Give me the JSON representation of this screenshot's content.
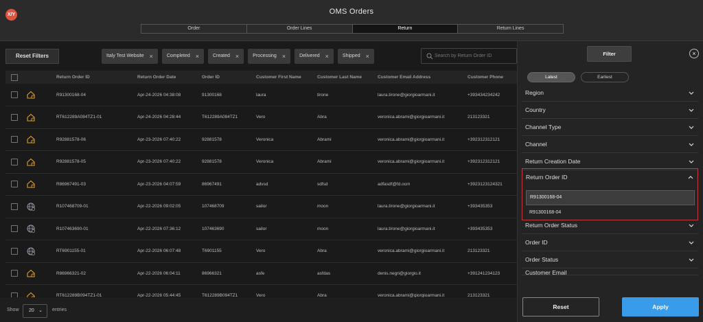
{
  "app": {
    "logo_text": "X/Y",
    "title": "OMS Orders"
  },
  "tabs": [
    {
      "label": "Order",
      "active": false
    },
    {
      "label": "Order Lines",
      "active": false
    },
    {
      "label": "Return",
      "active": true
    },
    {
      "label": "Return Lines",
      "active": false
    }
  ],
  "toolbar": {
    "reset_filters_label": "Reset Filters",
    "chips": [
      "Italy Test Website",
      "Completed",
      "Created",
      "Processing",
      "Delivered",
      "Shipped"
    ],
    "search_placeholder": "Search by Return Order ID"
  },
  "table": {
    "columns": [
      "Return Order ID",
      "Return Order Date",
      "Order ID",
      "Customer First Name",
      "Customer Last Name",
      "Customer Email Address",
      "Customer Phone"
    ],
    "rows": [
      {
        "icon": "home-icon",
        "id": "R91300168-04",
        "date": "Apr-24-2026 04:38:08",
        "order_id": "91300168",
        "first": "laura",
        "last": "tirone",
        "email": "laura.tirone@giorgioarmani.it",
        "phone": "+393434234242"
      },
      {
        "icon": "home-icon",
        "id": "RT612289A084TZ1-01",
        "date": "Apr-24-2026 04:28:44",
        "order_id": "T612289A084TZ1",
        "first": "Vero",
        "last": "Abra",
        "email": "veronica.abrami@giorgioarmani.it",
        "phone": "213123321"
      },
      {
        "icon": "home-icon",
        "id": "R92881578-06",
        "date": "Apr-23-2026 07:40:22",
        "order_id": "92881578",
        "first": "Veronica",
        "last": "Abrami",
        "email": "veronica.abrami@giorgioarmani.it",
        "phone": "+392312312121"
      },
      {
        "icon": "home-icon",
        "id": "R92881578-05",
        "date": "Apr-23-2026 07:40:22",
        "order_id": "92881578",
        "first": "Veronica",
        "last": "Abrami",
        "email": "veronica.abrami@giorgioarmani.it",
        "phone": "+392312312121"
      },
      {
        "icon": "home-icon",
        "id": "R86967491-03",
        "date": "Apr-23-2026 04:07:59",
        "order_id": "86967491",
        "first": "advsd",
        "last": "sdfsd",
        "email": "adfasdf@fd.ocm",
        "phone": "+3923123124321"
      },
      {
        "icon": "globe-icon",
        "id": "R107468709-01",
        "date": "Apr-22-2026 09:02:05",
        "order_id": "107468709",
        "first": "sailor",
        "last": "moon",
        "email": "laura.tirone@giorgioarmani.it",
        "phone": "+393435353"
      },
      {
        "icon": "globe-icon",
        "id": "R107463690-01",
        "date": "Apr-22-2026 07:36:12",
        "order_id": "107463690",
        "first": "sailor",
        "last": "moon",
        "email": "laura.tirone@giorgioarmani.it",
        "phone": "+393435353"
      },
      {
        "icon": "globe-icon",
        "id": "RT6901155-01",
        "date": "Apr-22-2026 06:07:48",
        "order_id": "T6901155",
        "first": "Vero",
        "last": "Abra",
        "email": "veronica.abrami@giorgioarmani.it",
        "phone": "213123321"
      },
      {
        "icon": "home-icon",
        "id": "R86966321-02",
        "date": "Apr-22-2026 06:04:11",
        "order_id": "86966321",
        "first": "asfe",
        "last": "asfdas",
        "email": "denis.negri@giorgio.it",
        "phone": "+391241234123"
      },
      {
        "icon": "home-icon",
        "id": "RT612289B094TZ1-01",
        "date": "Apr-22-2026 05:44:45",
        "order_id": "T612289B094TZ1",
        "first": "Vero",
        "last": "Abra",
        "email": "veronica.abrami@giorgioarmani.it",
        "phone": "213123321"
      }
    ]
  },
  "footer": {
    "show_label": "Show",
    "page_size": "20",
    "entries_label": "entries"
  },
  "panel": {
    "filter_label": "Filter",
    "sort": {
      "latest": "Latest",
      "earliest": "Earliest"
    },
    "facets_top": [
      "Region",
      "Country",
      "Channel Type",
      "Channel",
      "Return Creation Date"
    ],
    "open_facet": {
      "title": "Return Order ID",
      "input_value": "R91300168-04",
      "option": "R91300168-04"
    },
    "facets_bottom": [
      "Return Order Status",
      "Order ID",
      "Order Status",
      "Customer Email"
    ],
    "reset_label": "Reset",
    "apply_label": "Apply"
  },
  "colors": {
    "accent": "#3a9be8",
    "highlight_border": "#c23a3a",
    "icon": "#e0a030"
  }
}
